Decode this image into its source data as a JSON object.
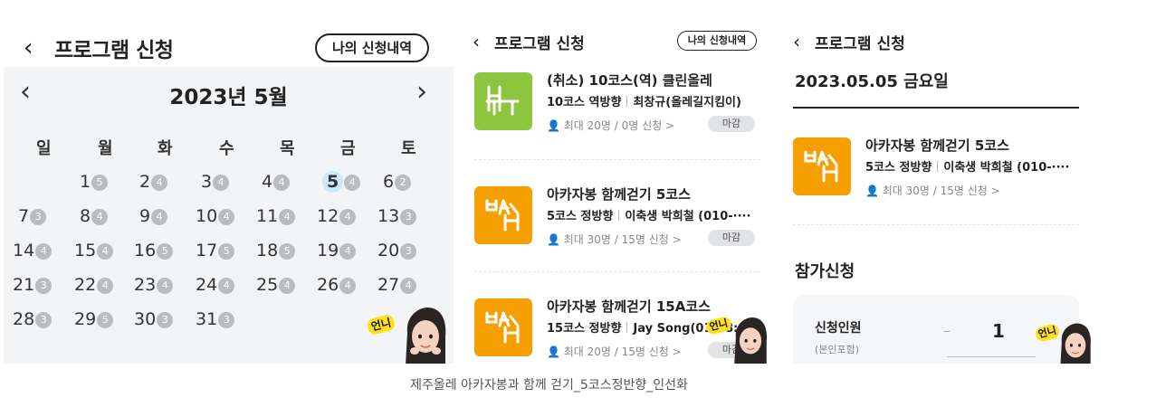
{
  "panel1": {
    "header": {
      "back_icon": "‹",
      "title": "프로그램 신청",
      "history_button": "나의 신청내역"
    },
    "calendar": {
      "prev_icon": "‹",
      "next_icon": "›",
      "month_label": "2023년 5월",
      "weekdays": [
        "일",
        "월",
        "화",
        "수",
        "목",
        "금",
        "토"
      ],
      "weeks": [
        [
          null,
          {
            "d": "1",
            "c": "5"
          },
          {
            "d": "2",
            "c": "4"
          },
          {
            "d": "3",
            "c": "4"
          },
          {
            "d": "4",
            "c": "4"
          },
          {
            "d": "5",
            "c": "4",
            "today": true
          },
          {
            "d": "6",
            "c": "2"
          }
        ],
        [
          {
            "d": "7",
            "c": "3"
          },
          {
            "d": "8",
            "c": "4"
          },
          {
            "d": "9",
            "c": "4"
          },
          {
            "d": "10",
            "c": "4"
          },
          {
            "d": "11",
            "c": "4"
          },
          {
            "d": "12",
            "c": "4"
          },
          {
            "d": "13",
            "c": "3"
          }
        ],
        [
          {
            "d": "14",
            "c": "4"
          },
          {
            "d": "15",
            "c": "4"
          },
          {
            "d": "16",
            "c": "5"
          },
          {
            "d": "17",
            "c": "5"
          },
          {
            "d": "18",
            "c": "5"
          },
          {
            "d": "19",
            "c": "4"
          },
          {
            "d": "20",
            "c": "3"
          }
        ],
        [
          {
            "d": "21",
            "c": "3"
          },
          {
            "d": "22",
            "c": "4"
          },
          {
            "d": "23",
            "c": "4"
          },
          {
            "d": "24",
            "c": "4"
          },
          {
            "d": "25",
            "c": "4"
          },
          {
            "d": "26",
            "c": "4"
          },
          {
            "d": "27",
            "c": "4"
          }
        ],
        [
          {
            "d": "28",
            "c": "3"
          },
          {
            "d": "29",
            "c": "5"
          },
          {
            "d": "30",
            "c": "3"
          },
          {
            "d": "31",
            "c": "3"
          },
          null,
          null,
          null
        ]
      ]
    },
    "sticker": "언니"
  },
  "panel2": {
    "header": {
      "back_icon": "‹",
      "title": "프로그램 신청",
      "history_button": "나의 신청내역"
    },
    "programs": [
      {
        "title": "(취소) 10코스(역) 클린올레",
        "course": "10코스 역방향",
        "leader": "최창규(올레길지킴이)",
        "capacity": "최대 20명 / 0명 신청 >",
        "status": "마감",
        "color": "#8cc63f",
        "icon": "chair-icon"
      },
      {
        "title": "아카자봉 함께걷기 5코스",
        "course": "5코스 정방향",
        "leader": "이축생 박희철 (010-····",
        "capacity": "최대 30명 / 15명 신청 >",
        "status": "마감",
        "color": "#f5a000",
        "icon": "walker-icon"
      },
      {
        "title": "아카자봉 함께걷기 15A코스",
        "course": "15코스 정방향",
        "leader": "Jay Song(010-8:",
        "capacity": "최대 20명 / 15명 신청 >",
        "status": "마감",
        "color": "#f5a000",
        "icon": "walker-icon"
      }
    ],
    "sticker": "언니"
  },
  "panel3": {
    "header": {
      "back_icon": "‹",
      "title": "프로그램 신청"
    },
    "date": "2023.05.05 금요일",
    "program": {
      "title": "아카자봉 함께걷기 5코스",
      "course": "5코스 정방향",
      "leader": "이축생 박희철 (010-····",
      "capacity": "최대 30명 / 15명 신청 >",
      "color": "#f5a000",
      "icon": "walker-icon"
    },
    "apply_heading": "참가신청",
    "applicants_label": "신청인원",
    "applicants_note": "(본인포함)",
    "minus": "–",
    "quantity": "1",
    "sticker": "언니"
  },
  "caption": "제주올레 아카자봉과 함께 걷기_5코스정반향_인선화"
}
